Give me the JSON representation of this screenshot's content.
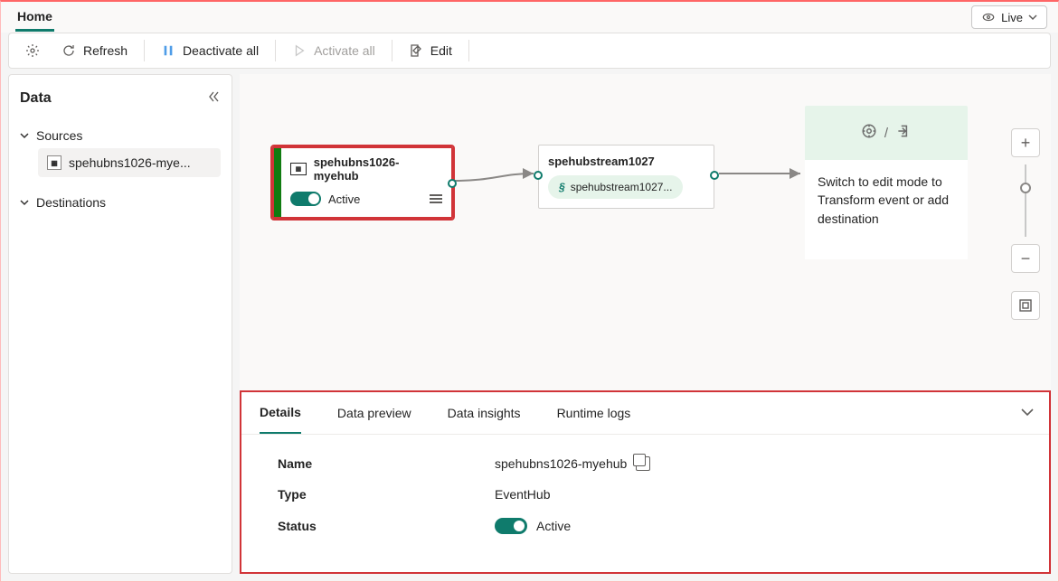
{
  "header": {
    "home_label": "Home",
    "live_label": "Live"
  },
  "toolbar": {
    "refresh_label": "Refresh",
    "deactivate_label": "Deactivate all",
    "activate_label": "Activate all",
    "edit_label": "Edit"
  },
  "sidebar": {
    "title": "Data",
    "sources_label": "Sources",
    "destinations_label": "Destinations",
    "source_item": "spehubns1026-mye..."
  },
  "canvas": {
    "source_node": {
      "title": "spehubns1026-myehub",
      "status": "Active"
    },
    "stream_node": {
      "title": "spehubstream1027",
      "pill": "spehubstream1027..."
    },
    "dest_node": {
      "text": "Switch to edit mode to Transform event or add destination"
    }
  },
  "details_panel": {
    "tabs": {
      "details": "Details",
      "preview": "Data preview",
      "insights": "Data insights",
      "logs": "Runtime logs"
    },
    "rows": {
      "name_label": "Name",
      "name_value": "spehubns1026-myehub",
      "type_label": "Type",
      "type_value": "EventHub",
      "status_label": "Status",
      "status_value": "Active"
    }
  }
}
